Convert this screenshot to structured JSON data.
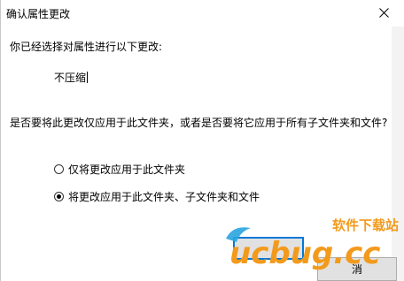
{
  "dialog": {
    "title": "确认属性更改",
    "prompt": "你已经选择对属性进行以下更改:",
    "attribute_change": "不压缩",
    "question": "是否要将此更改仅应用于此文件夹，或者是否要将它应用于所有子文件夹和文件?",
    "options": [
      {
        "label": "仅将更改应用于此文件夹",
        "selected": false
      },
      {
        "label": "将更改应用于此文件夹、子文件夹和文件",
        "selected": true
      }
    ],
    "buttons": {
      "cancel_label": "消"
    }
  },
  "watermark": {
    "brand_text": "软件下载站",
    "logo_text": "ucbug.cc"
  },
  "colors": {
    "accent": "#0078d7",
    "watermark_orange": "#f39a1c",
    "watermark_blue": "#2aa4df"
  }
}
